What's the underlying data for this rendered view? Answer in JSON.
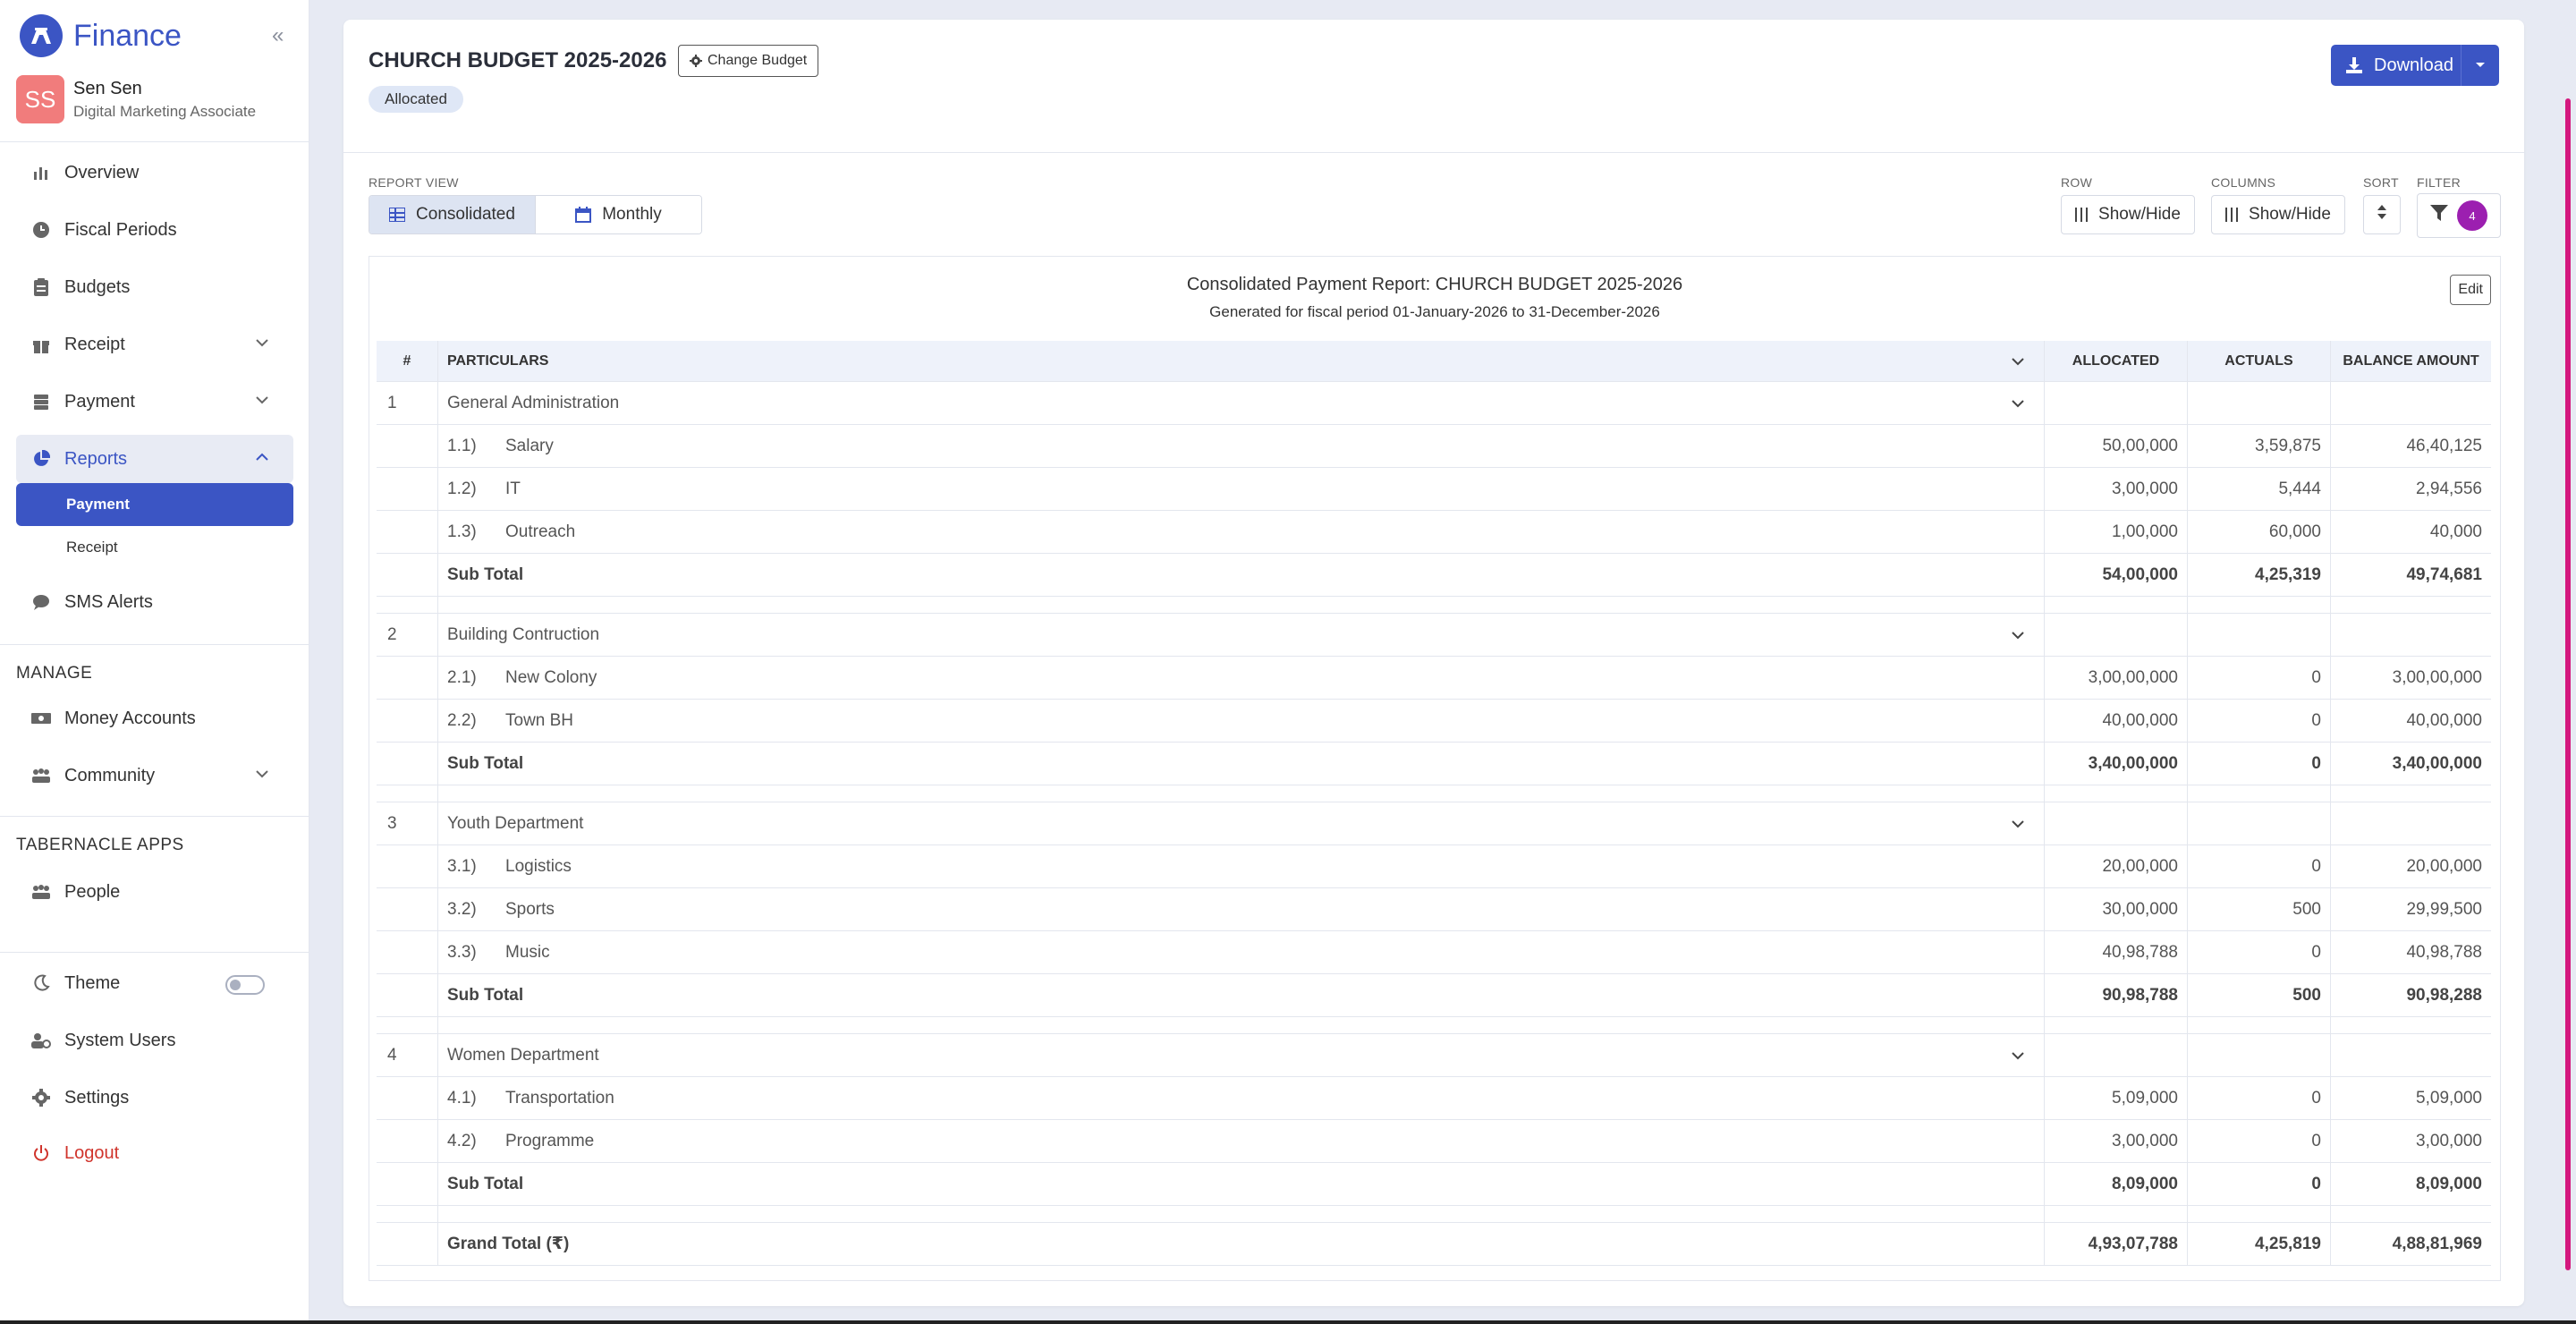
{
  "app": {
    "name": "Finance"
  },
  "user": {
    "initials": "SS",
    "name": "Sen Sen",
    "role": "Digital Marketing Associate"
  },
  "nav": {
    "overview": "Overview",
    "fiscal_periods": "Fiscal Periods",
    "budgets": "Budgets",
    "receipt": "Receipt",
    "payment": "Payment",
    "reports": "Reports",
    "reports_sub": [
      "Payment",
      "Receipt"
    ],
    "sms_alerts": "SMS Alerts",
    "manage_title": "MANAGE",
    "money_accounts": "Money Accounts",
    "community": "Community",
    "apps_title": "TABERNACLE APPS",
    "people": "People",
    "theme": "Theme",
    "system_users": "System Users",
    "settings": "Settings",
    "logout": "Logout"
  },
  "header": {
    "title": "CHURCH BUDGET 2025-2026",
    "change_budget": "Change Budget",
    "status_badge": "Allocated",
    "download": "Download"
  },
  "controls": {
    "report_view_label": "REPORT VIEW",
    "consolidated": "Consolidated",
    "monthly": "Monthly",
    "row_label": "ROW",
    "row_btn": "Show/Hide",
    "columns_label": "COLUMNS",
    "columns_btn": "Show/Hide",
    "sort_label": "SORT",
    "filter_label": "FILTER",
    "filter_count": "4"
  },
  "report": {
    "title": "Consolidated Payment Report: CHURCH BUDGET 2025-2026",
    "subtitle": "Generated for fiscal period 01-January-2026 to 31-December-2026",
    "edit": "Edit",
    "columns": [
      "#",
      "PARTICULARS",
      "ALLOCATED",
      "ACTUALS",
      "BALANCE AMOUNT"
    ],
    "categories": [
      {
        "num": "1",
        "name": "General Administration",
        "items": [
          {
            "code": "1.1)",
            "name": "Salary",
            "allocated": "50,00,000",
            "actuals": "3,59,875",
            "balance": "46,40,125"
          },
          {
            "code": "1.2)",
            "name": "IT",
            "allocated": "3,00,000",
            "actuals": "5,444",
            "balance": "2,94,556"
          },
          {
            "code": "1.3)",
            "name": "Outreach",
            "allocated": "1,00,000",
            "actuals": "60,000",
            "balance": "40,000"
          }
        ],
        "subtotal": {
          "label": "Sub Total",
          "allocated": "54,00,000",
          "actuals": "4,25,319",
          "balance": "49,74,681"
        }
      },
      {
        "num": "2",
        "name": "Building Contruction",
        "items": [
          {
            "code": "2.1)",
            "name": "New Colony",
            "allocated": "3,00,00,000",
            "actuals": "0",
            "balance": "3,00,00,000"
          },
          {
            "code": "2.2)",
            "name": "Town BH",
            "allocated": "40,00,000",
            "actuals": "0",
            "balance": "40,00,000"
          }
        ],
        "subtotal": {
          "label": "Sub Total",
          "allocated": "3,40,00,000",
          "actuals": "0",
          "balance": "3,40,00,000"
        }
      },
      {
        "num": "3",
        "name": "Youth Department",
        "items": [
          {
            "code": "3.1)",
            "name": "Logistics",
            "allocated": "20,00,000",
            "actuals": "0",
            "balance": "20,00,000"
          },
          {
            "code": "3.2)",
            "name": "Sports",
            "allocated": "30,00,000",
            "actuals": "500",
            "balance": "29,99,500"
          },
          {
            "code": "3.3)",
            "name": "Music",
            "allocated": "40,98,788",
            "actuals": "0",
            "balance": "40,98,788"
          }
        ],
        "subtotal": {
          "label": "Sub Total",
          "allocated": "90,98,788",
          "actuals": "500",
          "balance": "90,98,288"
        }
      },
      {
        "num": "4",
        "name": "Women Department",
        "items": [
          {
            "code": "4.1)",
            "name": "Transportation",
            "allocated": "5,09,000",
            "actuals": "0",
            "balance": "5,09,000"
          },
          {
            "code": "4.2)",
            "name": "Programme",
            "allocated": "3,00,000",
            "actuals": "0",
            "balance": "3,00,000"
          }
        ],
        "subtotal": {
          "label": "Sub Total",
          "allocated": "8,09,000",
          "actuals": "0",
          "balance": "8,09,000"
        }
      }
    ],
    "grand_total": {
      "label": "Grand Total (₹)",
      "allocated": "4,93,07,788",
      "actuals": "4,25,819",
      "balance": "4,88,81,969"
    }
  },
  "colors": {
    "primary": "#3b55c4",
    "logout": "#d0342c",
    "filter_badge": "#9c1fb0",
    "scroll_accent": "#d4187e"
  }
}
